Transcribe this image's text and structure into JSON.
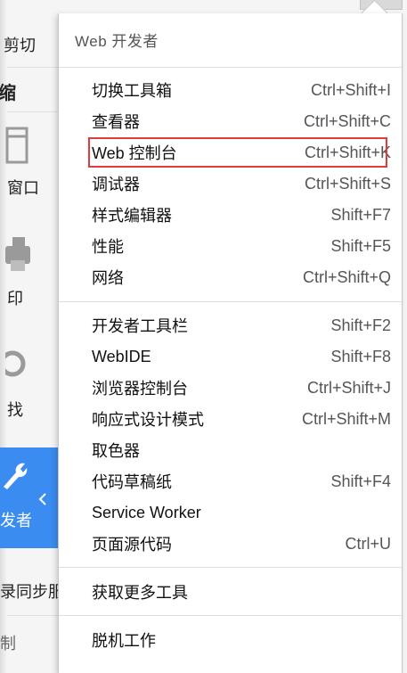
{
  "background_panel": {
    "items": [
      {
        "name": "cut",
        "label": "剪切"
      },
      {
        "name": "zoom",
        "label": "缩"
      },
      {
        "name": "new-window",
        "label": "窗口"
      },
      {
        "name": "print",
        "label": "印"
      },
      {
        "name": "find",
        "label": "找"
      },
      {
        "name": "developer",
        "label": "发者"
      },
      {
        "name": "sync",
        "label": "录同步服"
      },
      {
        "name": "customize",
        "label": "制"
      }
    ],
    "developer_tile_color": "#3a8cf0"
  },
  "menu": {
    "header": "Web 开发者",
    "groups": [
      [
        {
          "label": "切换工具箱",
          "shortcut": "Ctrl+Shift+I"
        },
        {
          "label": "查看器",
          "shortcut": "Ctrl+Shift+C"
        },
        {
          "label": "Web 控制台",
          "shortcut": "Ctrl+Shift+K",
          "highlighted": true
        },
        {
          "label": "调试器",
          "shortcut": "Ctrl+Shift+S"
        },
        {
          "label": "样式编辑器",
          "shortcut": "Shift+F7"
        },
        {
          "label": "性能",
          "shortcut": "Shift+F5"
        },
        {
          "label": "网络",
          "shortcut": "Ctrl+Shift+Q"
        }
      ],
      [
        {
          "label": "开发者工具栏",
          "shortcut": "Shift+F2"
        },
        {
          "label": "WebIDE",
          "shortcut": "Shift+F8"
        },
        {
          "label": "浏览器控制台",
          "shortcut": "Ctrl+Shift+J"
        },
        {
          "label": "响应式设计模式",
          "shortcut": "Ctrl+Shift+M"
        },
        {
          "label": "取色器",
          "shortcut": ""
        },
        {
          "label": "代码草稿纸",
          "shortcut": "Shift+F4"
        },
        {
          "label": "Service Worker",
          "shortcut": ""
        },
        {
          "label": "页面源代码",
          "shortcut": "Ctrl+U"
        }
      ],
      [
        {
          "label": "获取更多工具",
          "shortcut": ""
        }
      ],
      [
        {
          "label": "脱机工作",
          "shortcut": ""
        }
      ]
    ],
    "highlight_color": "#e03c3c"
  }
}
